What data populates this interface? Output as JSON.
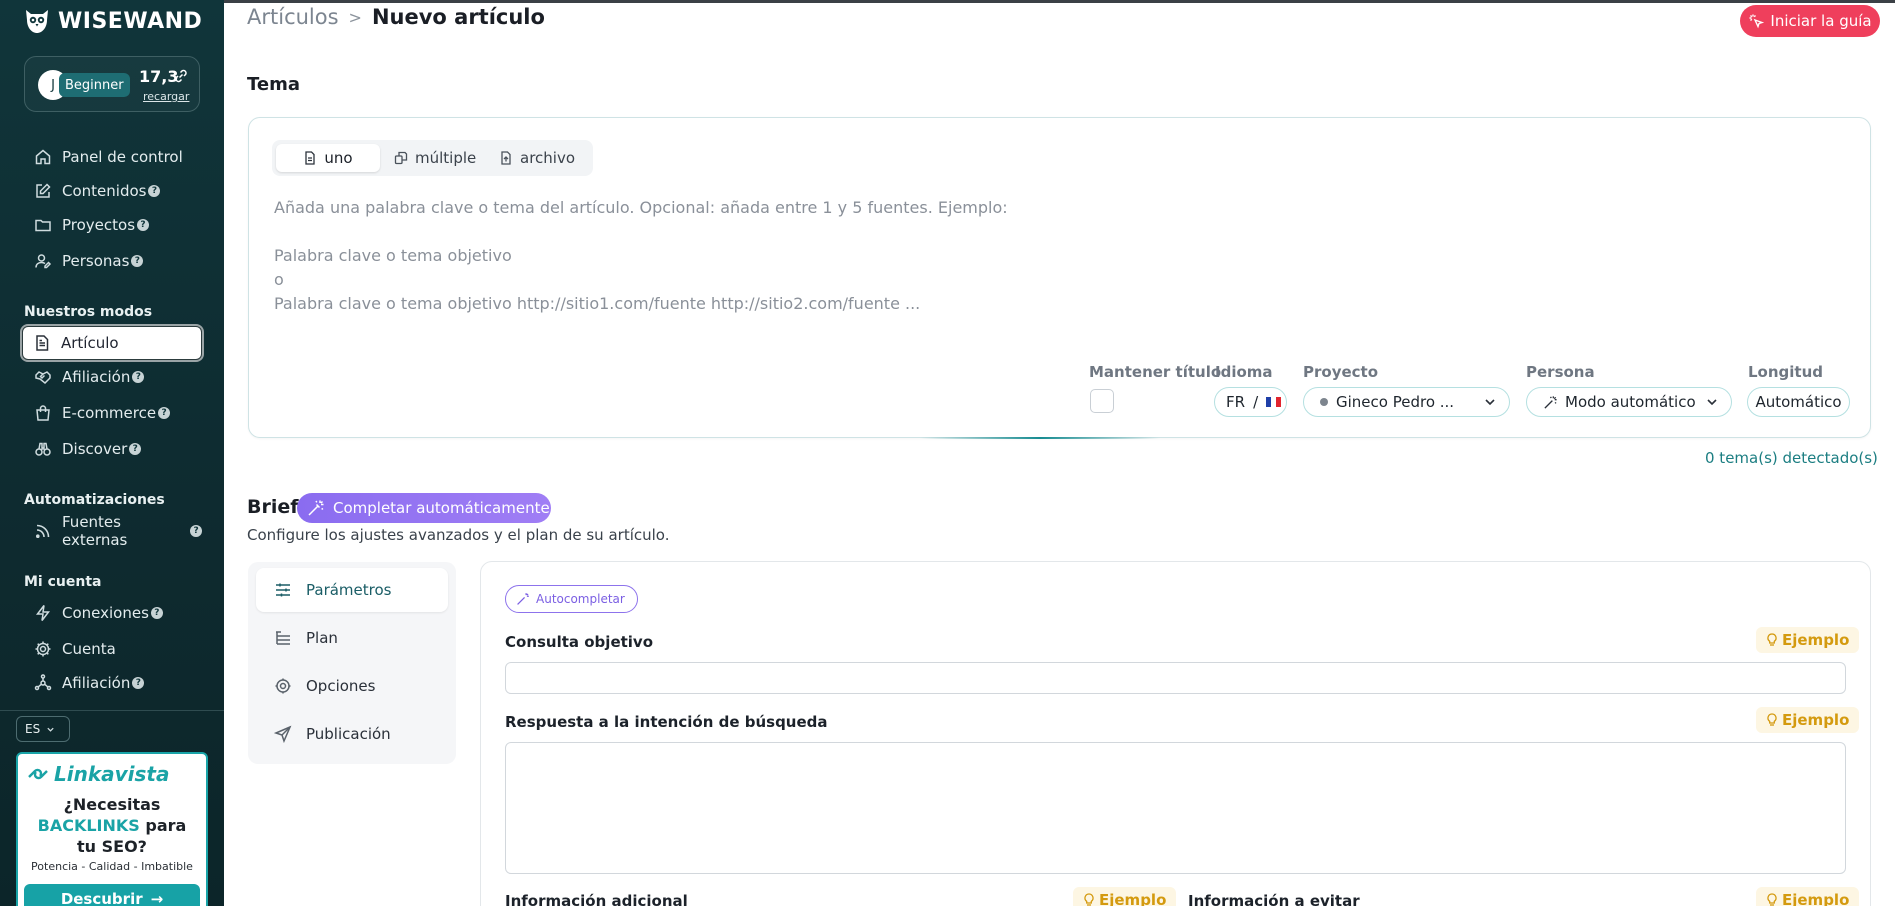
{
  "brand": {
    "name": "WISEWAND"
  },
  "account": {
    "avatar_initial": "J",
    "level": "Beginner",
    "credits": "17,3",
    "reload_label": "recargar"
  },
  "sidebar": {
    "main_items": [
      {
        "label": "Panel de control"
      },
      {
        "label": "Contenidos"
      },
      {
        "label": "Proyectos"
      },
      {
        "label": "Personas"
      }
    ],
    "modes_title": "Nuestros modos",
    "modes_items": [
      {
        "label": "Artículo"
      },
      {
        "label": "Afiliación"
      },
      {
        "label": "E-commerce"
      },
      {
        "label": "Discover"
      }
    ],
    "automation_title": "Automatizaciones",
    "automation_items": [
      {
        "label": "Fuentes externas"
      }
    ],
    "account_title": "Mi cuenta",
    "account_items": [
      {
        "label": "Conexiones"
      },
      {
        "label": "Cuenta"
      },
      {
        "label": "Afiliación"
      }
    ],
    "help_glyph": "?",
    "language": "ES"
  },
  "ad": {
    "brand": "Linkavista",
    "headline_line1": "¿Necesitas",
    "headline_highlight": "BACKLINKS",
    "headline_line2_rest": " para",
    "headline_line3": "tu SEO?",
    "tagline": "Potencia - Calidad - Imbatible",
    "cta": "Descubrir",
    "cta_arrow": "→"
  },
  "header": {
    "breadcrumb_parent": "Artículos",
    "breadcrumb_separator": ">",
    "breadcrumb_current": "Nuevo artículo",
    "guide_button": "Iniciar la guía"
  },
  "tema": {
    "title": "Tema",
    "tabs": [
      {
        "label": "uno"
      },
      {
        "label": "múltiple"
      },
      {
        "label": "archivo"
      }
    ],
    "placeholder": "Añada una palabra clave o tema del artículo. Opcional: añada entre 1 y 5 fuentes. Ejemplo:\n\nPalabra clave o tema objetivo\no\nPalabra clave o tema objetivo http://sitio1.com/fuente http://sitio2.com/fuente ...",
    "keep_title_label": "Mantener título",
    "language_label": "Idioma",
    "language_value": "FR",
    "language_sep": "/",
    "project_label": "Proyecto",
    "project_value": "Gineco Pedro ...",
    "persona_label": "Persona",
    "persona_value": "Modo automático",
    "length_label": "Longitud",
    "length_value": "Automático",
    "topics_detected": "0 tema(s) detectado(s)"
  },
  "brief": {
    "title": "Brief",
    "autofill_button": "Completar automáticamente",
    "subtitle": "Configure los ajustes avanzados y el plan de su artículo.",
    "nav": [
      {
        "label": "Parámetros"
      },
      {
        "label": "Plan"
      },
      {
        "label": "Opciones"
      },
      {
        "label": "Publicación"
      }
    ],
    "autofill_small": "Autocompletar",
    "example_label": "Ejemplo",
    "field_target_query": "Consulta objetivo",
    "field_search_intent": "Respuesta a la intención de búsqueda",
    "field_additional_info": "Información adicional",
    "field_avoid_info": "Información a evitar"
  },
  "colors": {
    "sidebar_bg": "#10353a",
    "accent_teal": "#1aa3a6",
    "guide_red": "#ef3f5c",
    "autofill_purple": "#8a6cf0",
    "example_gold": "#d49a0f"
  }
}
